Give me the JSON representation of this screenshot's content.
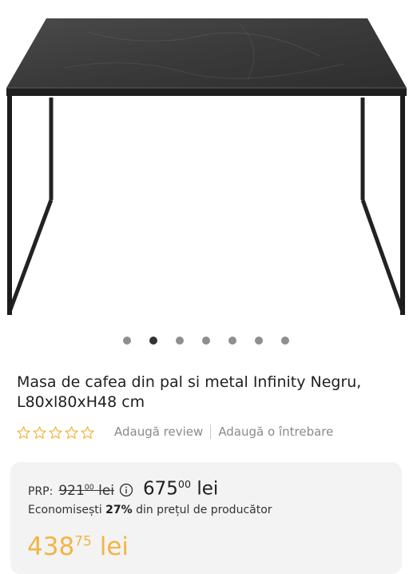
{
  "gallery": {
    "image_alt": "Masa de cafea Infinity Negru",
    "slide_count": 7,
    "active_slide": 2
  },
  "product": {
    "title": "Masa de cafea din pal si metal Infinity Negru, L80xl80xH48 cm"
  },
  "rating": {
    "stars_filled": 0,
    "stars_total": 5,
    "add_review": "Adaugă review",
    "add_question": "Adaugă o întrebare"
  },
  "pricing": {
    "prp_label": "PRP:",
    "old_price_int": "921",
    "old_price_dec": "00",
    "old_price_currency": "lei",
    "new_price_int": "675",
    "new_price_dec": "00",
    "new_price_currency": "lei",
    "savings_prefix": "Economisești",
    "savings_percent": "27%",
    "savings_suffix": "din prețul de producător",
    "final_price_int": "438",
    "final_price_dec": "75",
    "final_price_currency": "lei"
  },
  "colors": {
    "accent": "#f2b544",
    "star_outline": "#f2b544"
  },
  "icons": {
    "info": "info-icon",
    "star": "star-outline-icon"
  }
}
